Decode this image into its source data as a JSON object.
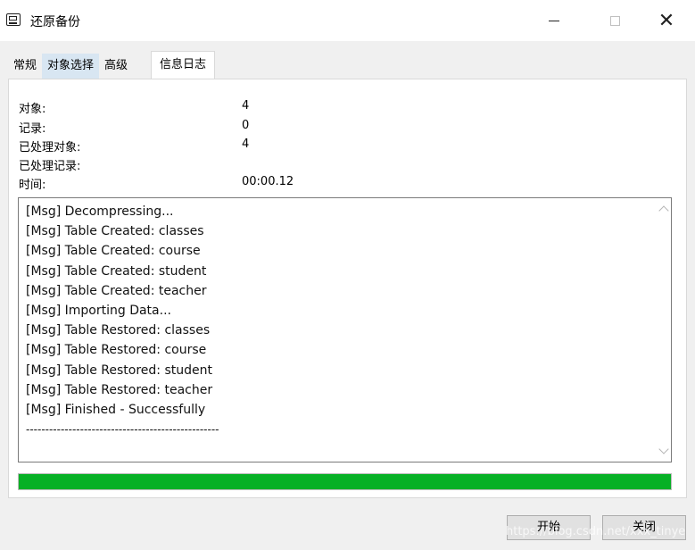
{
  "window": {
    "title": "还原备份",
    "icon": "database-backup-icon",
    "controls": {
      "minimize": "—",
      "maximize": "□",
      "close": "✕"
    }
  },
  "tabs": [
    {
      "label": "常规"
    },
    {
      "label": "对象选择"
    },
    {
      "label": "高级"
    },
    {
      "label": "信息日志"
    }
  ],
  "active_tab": "信息日志",
  "stats": {
    "objects_label": "对象:",
    "objects_value": "4",
    "records_label": "记录:",
    "records_value": "0",
    "processed_objects_label": "已处理对象:",
    "processed_objects_value": "4",
    "processed_records_label": "已处理记录:",
    "processed_records_value": "",
    "time_label": "时间:",
    "time_value": "00:00.12"
  },
  "log": {
    "lines": [
      "[Msg] Decompressing...",
      "[Msg] Table Created: classes",
      "[Msg] Table Created: course",
      "[Msg] Table Created: student",
      "[Msg] Table Created: teacher",
      "[Msg] Importing Data...",
      "[Msg] Table Restored: classes",
      "[Msg] Table Restored: course",
      "[Msg] Table Restored: student",
      "[Msg] Table Restored: teacher",
      "[Msg] Finished - Successfully",
      "--------------------------------------------------"
    ]
  },
  "progress": {
    "percent": 100,
    "color": "#06b025"
  },
  "buttons": {
    "start": "开始",
    "close": "关闭"
  },
  "watermark": "https://blog.csdn.net/xxx_tinye"
}
